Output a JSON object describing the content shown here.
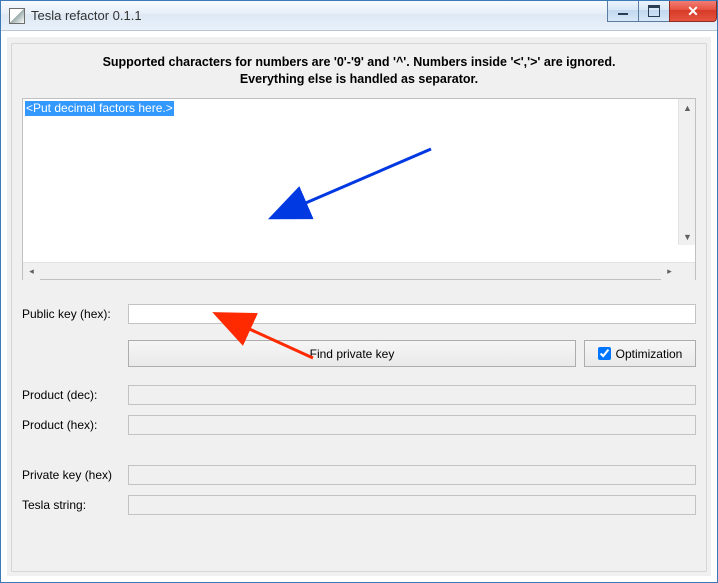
{
  "window": {
    "title": "Tesla refactor 0.1.1"
  },
  "hint": {
    "line1": "Supported characters for numbers are '0'-'9' and '^'. Numbers inside '<','>' are ignored.",
    "line2": "Everything else is handled as separator."
  },
  "factors": {
    "placeholder_selected": "<Put decimal factors here.>"
  },
  "labels": {
    "public_key": "Public key (hex):",
    "product_dec": "Product (dec):",
    "product_hex": "Product (hex):",
    "private_key": "Private key (hex)",
    "tesla_string": "Tesla string:"
  },
  "buttons": {
    "find": "Find private key"
  },
  "optimization": {
    "label": "Optimization",
    "checked": true
  },
  "fields": {
    "public_key": "",
    "product_dec": "",
    "product_hex": "",
    "private_key": "",
    "tesla_string": ""
  }
}
